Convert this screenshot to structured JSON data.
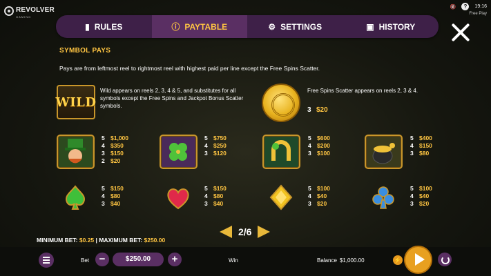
{
  "brand": {
    "name": "REVOLVER",
    "sub": "GAMING"
  },
  "status": {
    "time": "19:16",
    "mode": "Free Play",
    "mute_icon": "speaker-mute-icon",
    "help": "?"
  },
  "tabs": [
    {
      "label": "RULES",
      "icon": "book-icon",
      "active": false
    },
    {
      "label": "PAYTABLE",
      "icon": "info-icon",
      "active": true
    },
    {
      "label": "SETTINGS",
      "icon": "gear-icon",
      "active": false
    },
    {
      "label": "HISTORY",
      "icon": "calendar-icon",
      "active": false
    }
  ],
  "paytable": {
    "title": "SYMBOL PAYS",
    "intro": "Pays are from leftmost reel to rightmost reel with highest paid per line except the Free Spins Scatter.",
    "wild": {
      "label": "WILD",
      "desc": "Wild appears on reels 2, 3, 4 & 5, and substitutes for all symbols except the Free Spins and Jackpot Bonus Scatter symbols."
    },
    "scatter": {
      "desc": "Free Spins Scatter appears on reels 2, 3 & 4.",
      "pays": [
        {
          "n": "3",
          "v": "$20"
        }
      ]
    },
    "symbols": [
      {
        "name": "leprechaun",
        "pays": [
          {
            "n": "5",
            "v": "$1,000"
          },
          {
            "n": "4",
            "v": "$350"
          },
          {
            "n": "3",
            "v": "$150"
          },
          {
            "n": "2",
            "v": "$20"
          }
        ]
      },
      {
        "name": "four-leaf-clover",
        "pays": [
          {
            "n": "5",
            "v": "$750"
          },
          {
            "n": "4",
            "v": "$250"
          },
          {
            "n": "3",
            "v": "$120"
          }
        ]
      },
      {
        "name": "horseshoe",
        "pays": [
          {
            "n": "5",
            "v": "$600"
          },
          {
            "n": "4",
            "v": "$200"
          },
          {
            "n": "3",
            "v": "$100"
          }
        ]
      },
      {
        "name": "pot-of-gold",
        "pays": [
          {
            "n": "5",
            "v": "$400"
          },
          {
            "n": "4",
            "v": "$150"
          },
          {
            "n": "3",
            "v": "$80"
          }
        ]
      },
      {
        "name": "spade-gem",
        "pays": [
          {
            "n": "5",
            "v": "$150"
          },
          {
            "n": "4",
            "v": "$80"
          },
          {
            "n": "3",
            "v": "$40"
          }
        ]
      },
      {
        "name": "heart-gem",
        "pays": [
          {
            "n": "5",
            "v": "$150"
          },
          {
            "n": "4",
            "v": "$80"
          },
          {
            "n": "3",
            "v": "$40"
          }
        ]
      },
      {
        "name": "diamond-gem",
        "pays": [
          {
            "n": "5",
            "v": "$100"
          },
          {
            "n": "4",
            "v": "$40"
          },
          {
            "n": "3",
            "v": "$20"
          }
        ]
      },
      {
        "name": "club-gem",
        "pays": [
          {
            "n": "5",
            "v": "$100"
          },
          {
            "n": "4",
            "v": "$40"
          },
          {
            "n": "3",
            "v": "$20"
          }
        ]
      }
    ],
    "page": "2/6"
  },
  "bet_limits": {
    "min_label": "MINIMUM BET:",
    "min": "$0.25",
    "sep": "|",
    "max_label": "MAXIMUM BET:",
    "max": "$250.00"
  },
  "bottom": {
    "bet_label": "Bet",
    "bet_value": "$250.00",
    "minus": "−",
    "plus": "+",
    "win_label": "Win",
    "balance_label": "Balance",
    "balance_value": "$1,000.00",
    "turbo": "⚡"
  },
  "colors": {
    "accent": "#ffc542",
    "tab_bg": "#3e2048",
    "tab_active": "#5a2f63",
    "spin": "#e8a020"
  }
}
